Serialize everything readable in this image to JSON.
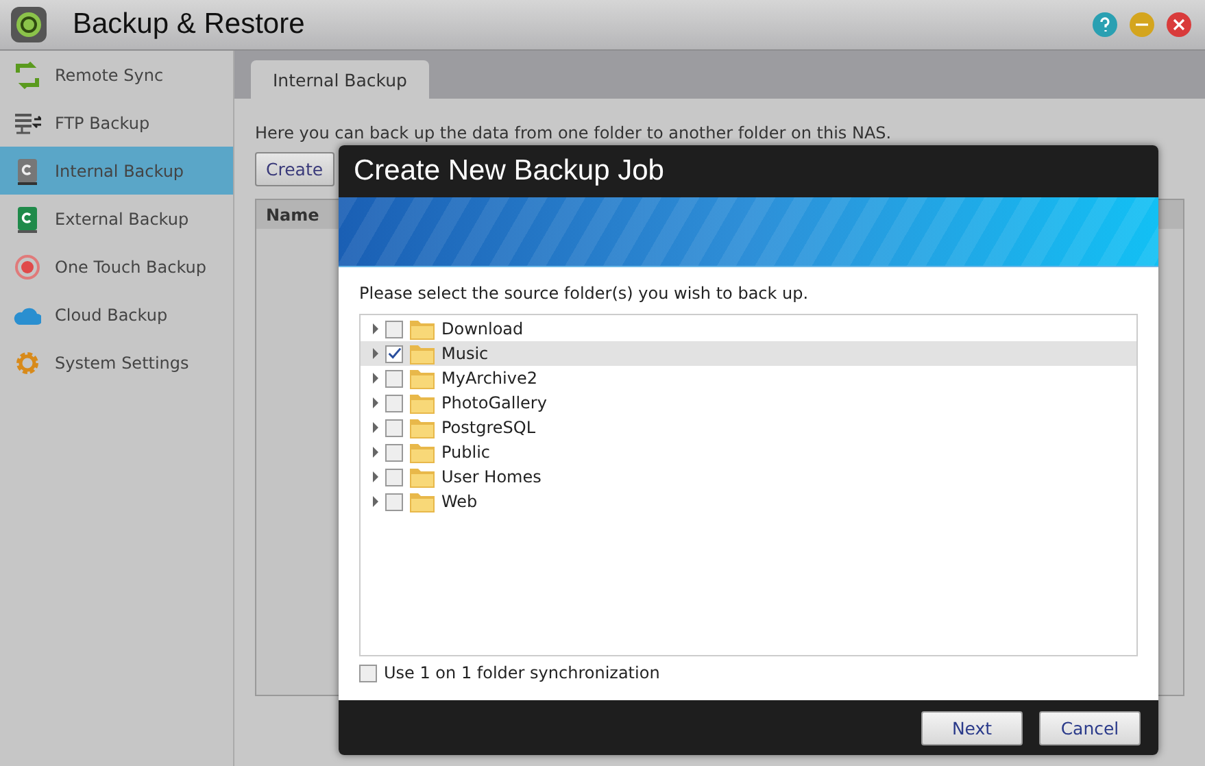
{
  "window": {
    "title": "Backup & Restore"
  },
  "sidebar": {
    "items": [
      {
        "label": "Remote Sync",
        "kind": "sync",
        "selected": false
      },
      {
        "label": "FTP Backup",
        "kind": "ftp",
        "selected": false
      },
      {
        "label": "Internal Backup",
        "kind": "internal",
        "selected": true
      },
      {
        "label": "External Backup",
        "kind": "external",
        "selected": false
      },
      {
        "label": "One Touch Backup",
        "kind": "touch",
        "selected": false
      },
      {
        "label": "Cloud Backup",
        "kind": "cloud",
        "selected": false
      },
      {
        "label": "System Settings",
        "kind": "gear",
        "selected": false
      }
    ]
  },
  "tabs": [
    {
      "label": "Internal Backup",
      "selected": true
    }
  ],
  "description": "Here you can back up the data from one folder to another folder on this NAS.",
  "toolbar": {
    "buttons": [
      "Create"
    ]
  },
  "table": {
    "columns": [
      "Name"
    ]
  },
  "dialog": {
    "title": "Create New Backup Job",
    "prompt": "Please select the source folder(s) you wish to back up.",
    "folders": [
      {
        "name": "Download",
        "checked": false,
        "selected": false
      },
      {
        "name": "Music",
        "checked": true,
        "selected": true
      },
      {
        "name": "MyArchive2",
        "checked": false,
        "selected": false
      },
      {
        "name": "PhotoGallery",
        "checked": false,
        "selected": false
      },
      {
        "name": "PostgreSQL",
        "checked": false,
        "selected": false
      },
      {
        "name": "Public",
        "checked": false,
        "selected": false
      },
      {
        "name": "User Homes",
        "checked": false,
        "selected": false
      },
      {
        "name": "Web",
        "checked": false,
        "selected": false
      }
    ],
    "sync_option": {
      "label": "Use 1 on 1 folder synchronization",
      "checked": false
    },
    "buttons": [
      "Next",
      "Cancel"
    ]
  }
}
